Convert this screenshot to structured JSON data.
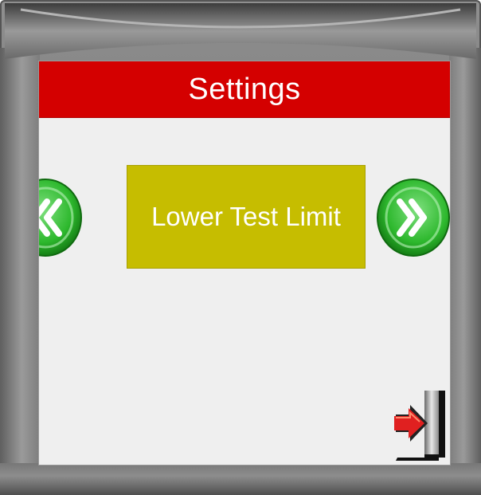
{
  "screen": {
    "title": "Settings",
    "parameter_label": "Lower Test Limit"
  },
  "navigation": {
    "previous_icon": "double-chevron-left-icon",
    "next_icon": "double-chevron-right-icon",
    "exit_icon": "exit-door-icon"
  },
  "colors": {
    "title_bar": "#d40000",
    "parameter_box": "#c6bd00",
    "nav_button": "#2db82d",
    "exit_arrow": "#e02020"
  }
}
